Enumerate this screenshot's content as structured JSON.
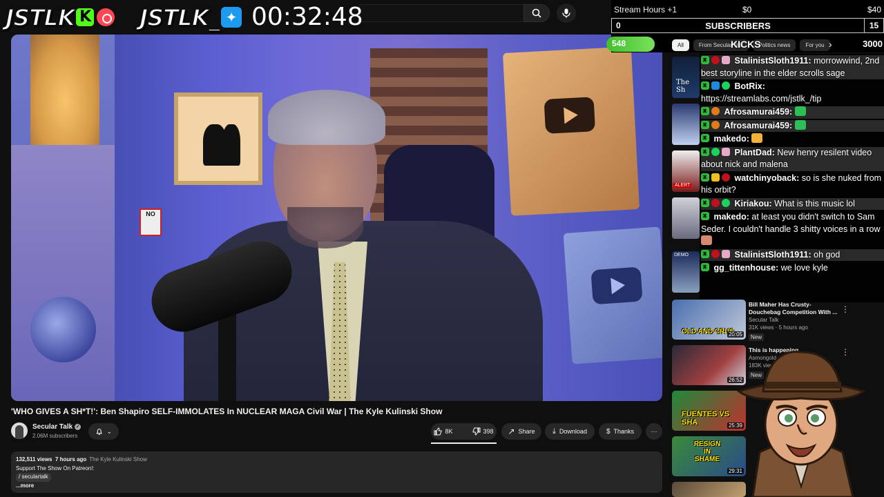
{
  "overlay": {
    "brand_left": "JSTLK",
    "brand_right": "JSTLK_",
    "timer": "00:32:48",
    "stream_hours_label": "Stream Hours +1",
    "stream_hours_min": "$0",
    "stream_hours_max": "$40",
    "subs_current": "0",
    "subs_label": "SUBSCRIBERS",
    "subs_goal": "15",
    "kicks_current": "548",
    "kicks_label": "KICKS",
    "kicks_goal": "3000",
    "kicks_progress": 0.18
  },
  "chips": [
    "All",
    "From Secular Talk",
    "Politics news",
    "For you"
  ],
  "chat": [
    {
      "user": "StalinistSloth1911:",
      "text": "morrowwind, 2nd best storyline in the elder scrolls sage",
      "highlight": true
    },
    {
      "user": "BotRix:",
      "text": "https://streamlabs.com/jstlk_/tip",
      "highlight": false
    },
    {
      "user": "Afrosamurai459:",
      "text": "",
      "highlight": true
    },
    {
      "user": "Afrosamurai459:",
      "text": "",
      "highlight": true
    },
    {
      "user": "makedo:",
      "text": "",
      "highlight": false
    },
    {
      "user": "PlantDad:",
      "text": "New henry resilent video about nick and malena",
      "highlight": true
    },
    {
      "user": "watchinyoback:",
      "text": "so is she nuked from his orbit?",
      "highlight": false
    },
    {
      "user": "Kiriakou:",
      "text": "What is this music lol",
      "highlight": true
    },
    {
      "user": "makedo:",
      "text": "at least you didn't switch to Sam Seder. I couldn't handle 3 shitty voices in a row",
      "highlight": false
    },
    {
      "user": "StalinistSloth1911:",
      "text": "oh god",
      "highlight": true
    },
    {
      "user": "gg_tittenhouse:",
      "text": "we love kyle",
      "highlight": false
    }
  ],
  "video": {
    "title": "'WHO GIVES A SH*T!': Ben Shapiro SELF-IMMOLATES In NUCLEAR MAGA Civil War | The Kyle Kulinski Show",
    "channel": "Secular Talk",
    "subscribers": "2.06M subscribers",
    "likes": "8K",
    "dislikes": "398",
    "share": "Share",
    "download": "Download",
    "thanks": "Thanks",
    "views": "132,511 views",
    "ago": "7 hours ago",
    "show_tag": "The Kyle Kulinski Show",
    "desc_line1": "Support The Show On Patreon!:",
    "desc_link": "/ seculartalk",
    "more": "...more"
  },
  "recommended": [
    {
      "title": "Bill Maher Has Crusty-Douchebag Competition With ...",
      "channel": "Secular Talk",
      "meta": "31K views · 5 hours ago",
      "badge": "New",
      "duration": "20:05",
      "caption": "OLD AND CRUS"
    },
    {
      "title": "This is happening",
      "channel": "Asmongold",
      "meta": "183K views",
      "badge": "New",
      "duration": "26:52",
      "caption": ""
    },
    {
      "duration": "25:39",
      "caption": "FUENTES VS SHA"
    },
    {
      "duration": "29:31",
      "caption": "RESIGN IN SHAME"
    }
  ],
  "sidebar_thumbs": [
    "The Sh",
    "ALERT",
    "DEMO"
  ],
  "colors": {
    "accent_green": "#53fc18",
    "youtube_bg": "#0f0f0f"
  }
}
